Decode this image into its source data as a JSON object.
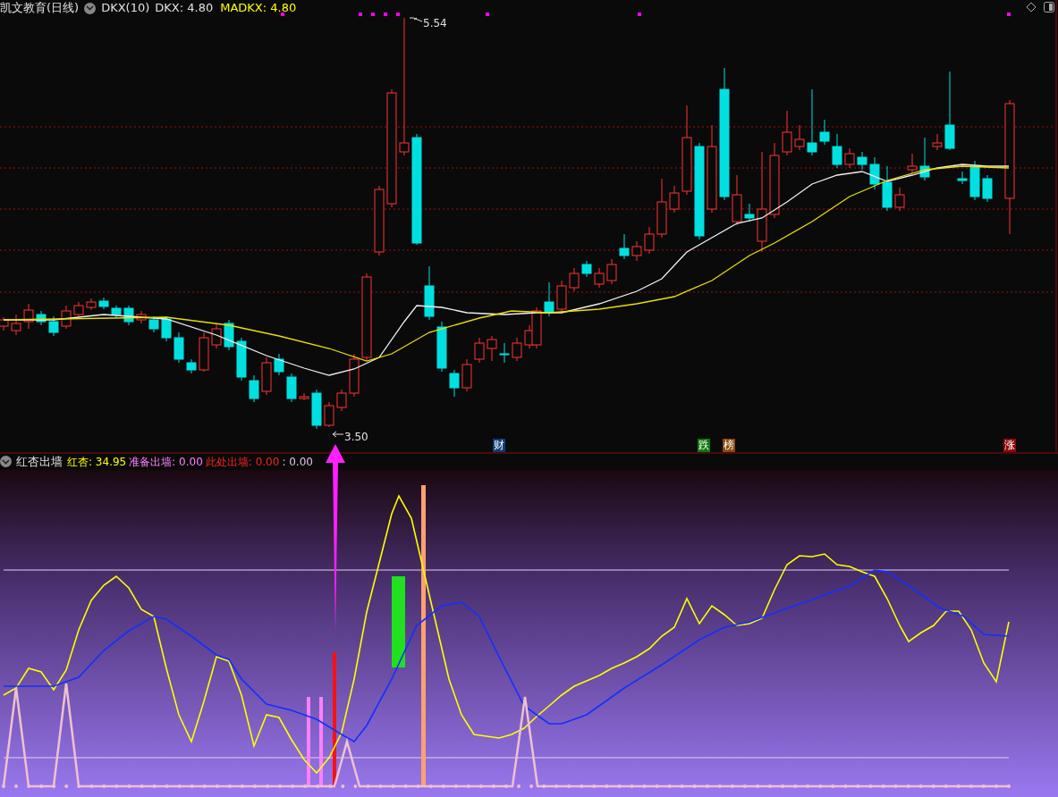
{
  "price_panel": {
    "title": "凯文教育(日线)",
    "indicator": "DKX(10)",
    "legend": [
      {
        "text": "DKX: 4.80",
        "color": "#e0e0e0"
      },
      {
        "text": "MADKX: 4.80",
        "color": "#ffff00"
      }
    ],
    "high_label": "5.54",
    "low_label": "3.50",
    "event_tags": [
      {
        "text": "财",
        "color": "#0e3a78"
      },
      {
        "text": "跌",
        "color": "#0a7a0a"
      },
      {
        "text": "榜",
        "color": "#8a4a0a"
      },
      {
        "text": "涨",
        "color": "#8a0a0a"
      }
    ]
  },
  "indicator_panel": {
    "title": "红杏出墙",
    "legend": [
      {
        "text": "红杏: 34.95",
        "color": "#ffff00"
      },
      {
        "text": "准备出墙: 0.00",
        "color": "#ff80ff"
      },
      {
        "text": "此处出墙: 0.00",
        "color": "#ff2020"
      },
      {
        "text": ": 0.00",
        "color": "#e0c0e0"
      }
    ]
  }
}
